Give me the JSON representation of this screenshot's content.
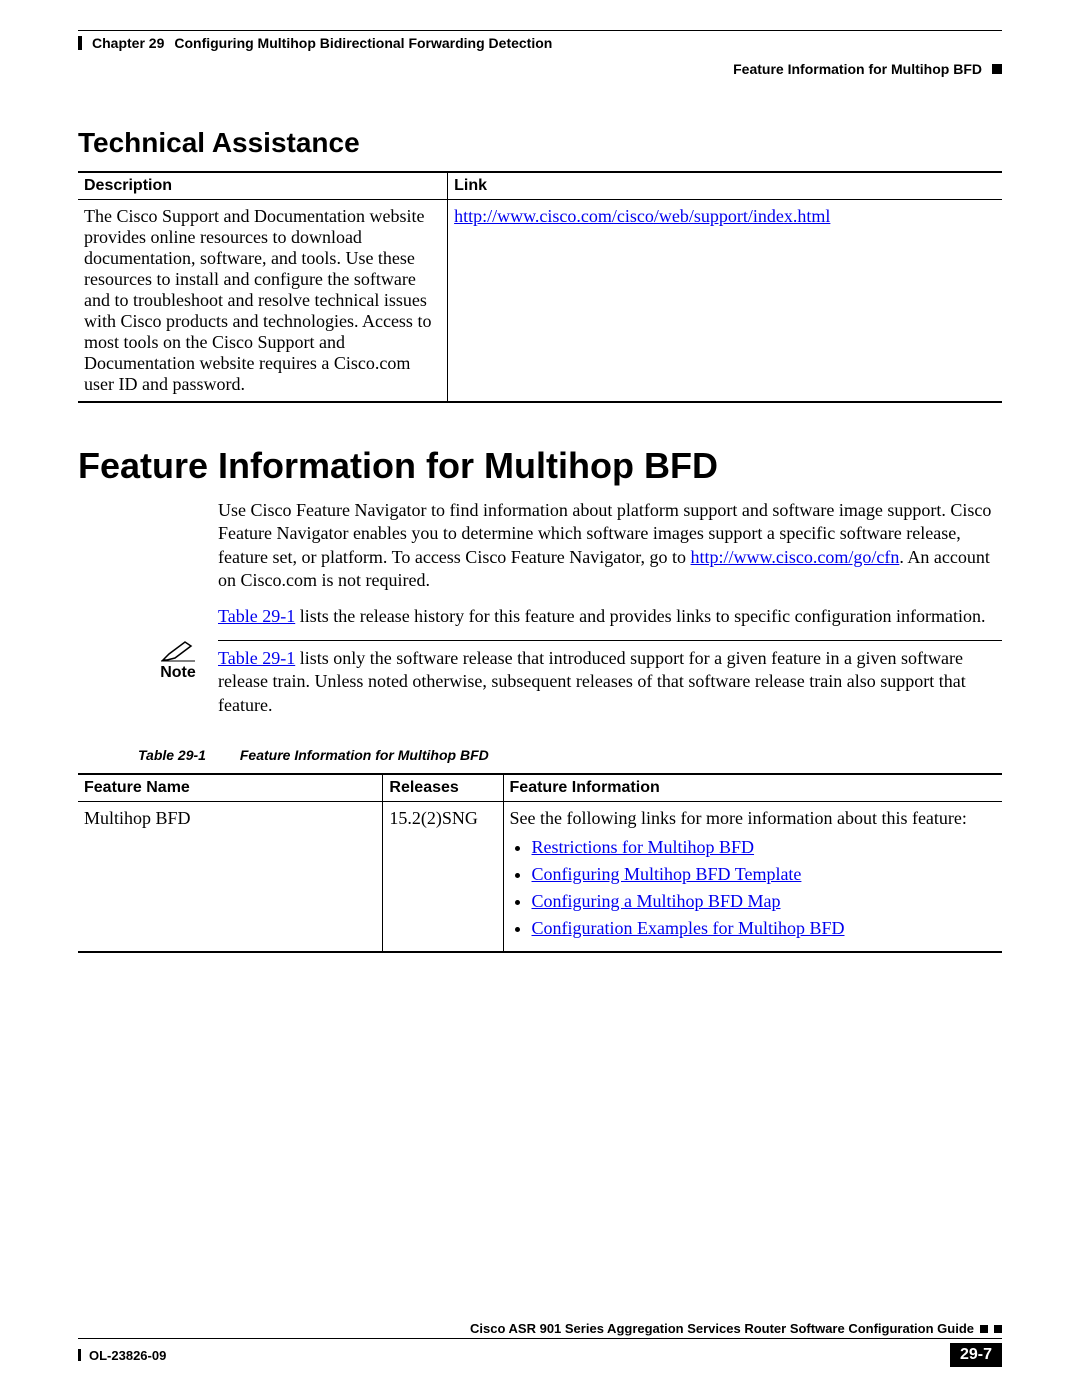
{
  "header": {
    "chapter_label": "Chapter 29",
    "chapter_title": "Configuring Multihop Bidirectional Forwarding Detection",
    "section_right": "Feature Information for Multihop BFD"
  },
  "tech_assist": {
    "heading": "Technical Assistance",
    "col_description": "Description",
    "col_link": "Link",
    "description_text": "The Cisco Support and Documentation website provides online resources to download documentation, software, and tools. Use these resources to install and configure the software and to troubleshoot and resolve technical issues with Cisco products and technologies. Access to most tools on the Cisco Support and Documentation website requires a Cisco.com user ID and password.",
    "link_text": "http://www.cisco.com/cisco/web/support/index.html"
  },
  "feature_info": {
    "heading": "Feature Information for Multihop BFD",
    "para1_pre": "Use Cisco Feature Navigator to find information about platform support and software image support. Cisco Feature Navigator enables you to determine which software images support a specific software release, feature set, or platform. To access Cisco Feature Navigator, go to ",
    "para1_link": "http://www.cisco.com/go/cfn",
    "para1_post": ". An account on Cisco.com is not required.",
    "para2_link": "Table 29-1",
    "para2_post": " lists the release history for this feature and provides links to specific configuration information.",
    "note_label": "Note",
    "note_link": "Table 29-1",
    "note_text": " lists only the software release that introduced support for a given feature in a given software release train. Unless noted otherwise, subsequent releases of that software release train also support that feature.",
    "table_caption_num": "Table 29-1",
    "table_caption_title": "Feature Information for Multihop BFD",
    "col_feature_name": "Feature Name",
    "col_releases": "Releases",
    "col_feature_information": "Feature Information",
    "row": {
      "feature_name": "Multihop BFD",
      "releases": "15.2(2)SNG",
      "info_intro": "See the following links for more information about this feature:",
      "links": [
        "Restrictions for Multihop BFD",
        "Configuring Multihop BFD Template",
        "Configuring a Multihop BFD Map",
        "Configuration Examples for Multihop BFD"
      ]
    }
  },
  "footer": {
    "guide_title": "Cisco ASR 901 Series Aggregation Services Router Software Configuration Guide",
    "doc_id": "OL-23826-09",
    "page_num": "29-7"
  }
}
